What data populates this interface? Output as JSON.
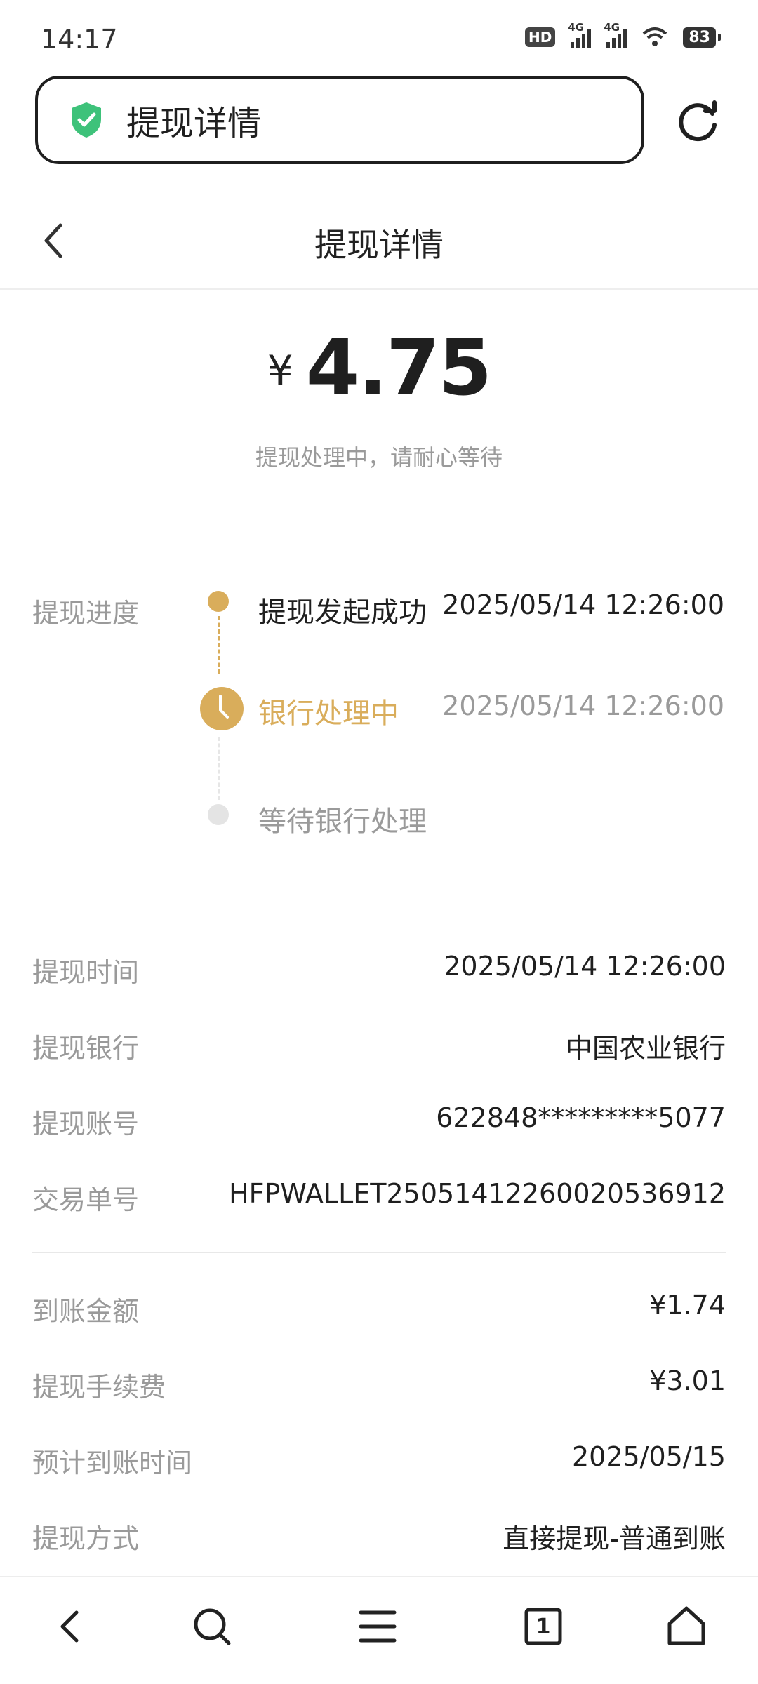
{
  "status_bar": {
    "time": "14:17",
    "hd_label": "HD",
    "network_1": "4G",
    "network_2": "4G",
    "battery": "83"
  },
  "browser": {
    "address_title": "提现详情",
    "icons": {
      "security": "shield-check-icon",
      "reload": "reload-icon"
    },
    "accent": "#3ec27a"
  },
  "header": {
    "title": "提现详情",
    "back_icon": "chevron-left-icon"
  },
  "amount": {
    "currency": "¥",
    "value": "4.75",
    "status_text": "提现处理中，请耐心等待"
  },
  "progress": {
    "label": "提现进度",
    "accent": "#d9ad5b",
    "steps": [
      {
        "title": "提现发起成功",
        "time": "2025/05/14 12:26:00",
        "state": "done"
      },
      {
        "title": "银行处理中",
        "time": "2025/05/14 12:26:00",
        "state": "current"
      },
      {
        "title": "等待银行处理",
        "time": "",
        "state": "pending"
      }
    ]
  },
  "details": [
    {
      "label": "提现时间",
      "value": "2025/05/14 12:26:00"
    },
    {
      "label": "提现银行",
      "value": "中国农业银行"
    },
    {
      "label": "提现账号",
      "value": "622848*********5077"
    },
    {
      "label": "交易单号",
      "value": "HFPWALLET2505141226002053691​2"
    }
  ],
  "fees": [
    {
      "label": "到账金额",
      "value": "¥1.74"
    },
    {
      "label": "提现手续费",
      "value": "¥3.01"
    },
    {
      "label": "预计到账时间",
      "value": "2025/05/15"
    },
    {
      "label": "提现方式",
      "value": "直接提现-普通到账"
    }
  ],
  "bottom_nav": {
    "items": [
      "back-icon",
      "search-icon",
      "menu-icon",
      "tabs-icon",
      "home-icon"
    ],
    "tab_count": "1"
  }
}
